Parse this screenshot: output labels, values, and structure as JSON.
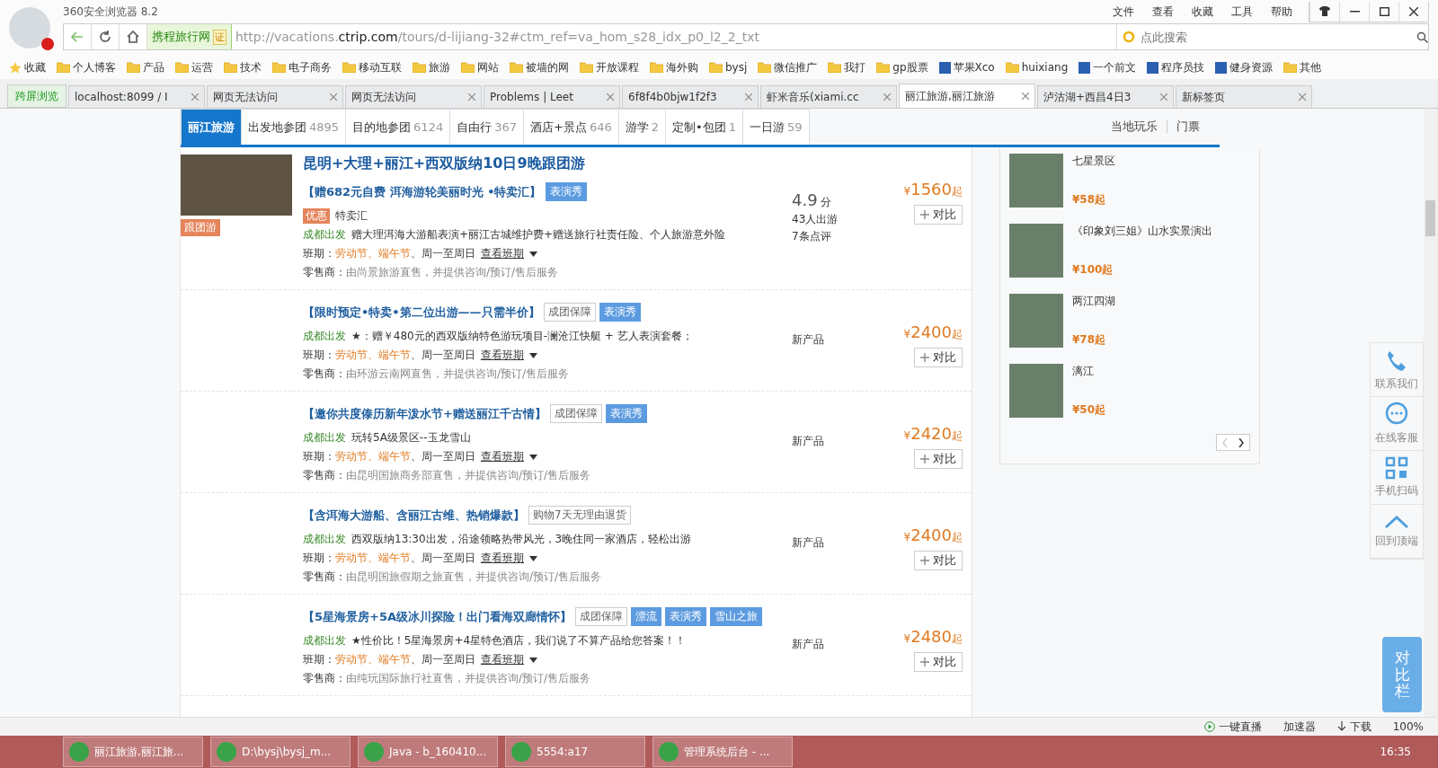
{
  "browser": {
    "title": "360安全浏览器 8.2",
    "menu": [
      "文件",
      "查看",
      "收藏",
      "工具",
      "帮助"
    ],
    "site_label": "携程旅行网",
    "cert": "证",
    "url_host_pre": "http://vacations.",
    "url_host": "ctrip.com",
    "url_path": "/tours/d-lijiang-32#ctm_ref=va_hom_s28_idx_p0_l2_2_txt",
    "search_placeholder": "点此搜索",
    "bookmarks": [
      {
        "label": "收藏",
        "kind": "star"
      },
      {
        "label": "个人博客",
        "kind": "folder"
      },
      {
        "label": "产品",
        "kind": "folder"
      },
      {
        "label": "运营",
        "kind": "folder"
      },
      {
        "label": "技术",
        "kind": "folder"
      },
      {
        "label": "电子商务",
        "kind": "folder"
      },
      {
        "label": "移动互联",
        "kind": "folder"
      },
      {
        "label": "旅游",
        "kind": "folder"
      },
      {
        "label": "网站",
        "kind": "folder"
      },
      {
        "label": "被墙的网",
        "kind": "folder"
      },
      {
        "label": "开放课程",
        "kind": "folder"
      },
      {
        "label": "海外购",
        "kind": "folder"
      },
      {
        "label": "bysj",
        "kind": "folder"
      },
      {
        "label": "微信推广",
        "kind": "folder"
      },
      {
        "label": "我打",
        "kind": "folder"
      },
      {
        "label": "gp股票",
        "kind": "folder"
      },
      {
        "label": "苹果Xco",
        "kind": "site"
      },
      {
        "label": "huixiang",
        "kind": "folder"
      },
      {
        "label": "一个前文",
        "kind": "site"
      },
      {
        "label": "程序员技",
        "kind": "site"
      },
      {
        "label": "健身资源",
        "kind": "site"
      },
      {
        "label": "其他",
        "kind": "folder"
      }
    ],
    "cross_screen": "跨屏浏览",
    "tabs": [
      {
        "label": "localhost:8099 / I",
        "selected": false
      },
      {
        "label": "网页无法访问",
        "selected": false
      },
      {
        "label": "网页无法访问",
        "selected": false
      },
      {
        "label": "Problems | Leet",
        "selected": false
      },
      {
        "label": "6f8f4b0bjw1f2f3",
        "selected": false
      },
      {
        "label": "虾米音乐(xiami.cc",
        "selected": false
      },
      {
        "label": "丽江旅游,丽江旅游",
        "selected": true
      },
      {
        "label": "泸沽湖+西昌4日3",
        "selected": false
      },
      {
        "label": "新标签页",
        "selected": false
      }
    ]
  },
  "nav": {
    "tabs": [
      {
        "label": "丽江旅游",
        "selected": true
      },
      {
        "label": "出发地参团",
        "count": "4895",
        "selected": false
      },
      {
        "label": "目的地参团",
        "count": "6124",
        "selected": false
      },
      {
        "label": "自由行",
        "count": "367",
        "selected": false
      },
      {
        "label": "酒店+景点",
        "count": "646",
        "selected": false
      },
      {
        "label": "游学",
        "count": "2",
        "selected": false
      },
      {
        "label": "定制•包团",
        "count": "1",
        "selected": false
      },
      {
        "label": "一日游",
        "count": "59",
        "selected": false
      }
    ],
    "links": [
      "当地玩乐",
      "门票"
    ]
  },
  "first_product": {
    "title": "昆明+大理+丽江+西双版纳10日9晚跟团游",
    "type_badge": "跟团游",
    "promo_badge": "优惠",
    "promo_text": "特卖汇",
    "score": "4.9",
    "score_unit": "分",
    "travelers": "43人出游",
    "reviews": "7条点评"
  },
  "products": [
    {
      "subtitle": "【赠682元自费 洱海游轮美丽时光 •特卖汇】",
      "tags": [
        {
          "label": "表演秀",
          "kind": "blue"
        }
      ],
      "departure": "成都出发",
      "desc": "赠大理洱海大游船表演+丽江古城维护费+赠送旅行社责任险、个人旅游意外险",
      "schedule_label": "班期：",
      "holidays": "劳动节、端午节",
      "days": "、周一至周日",
      "schedule_link": "查看班期",
      "retailer_label": "零售商：",
      "retailer": "由尚景旅游",
      "retailer_note": "直售，并提供咨询/预订/售后服务",
      "currency": "¥",
      "price": "1560",
      "suffix": "起",
      "compare": "对比"
    },
    {
      "subtitle": "【限时预定•特卖•第二位出游——只需半价】",
      "tags": [
        {
          "label": "成团保障",
          "kind": "plain"
        },
        {
          "label": "表演秀",
          "kind": "blue"
        }
      ],
      "departure": "成都出发",
      "desc": "★：赠￥480元的西双版纳特色游玩项目-澜沧江快艇 + 艺人表演套餐；",
      "schedule_label": "班期：",
      "holidays": "劳动节、端午节",
      "days": "、周一至周日",
      "schedule_link": "查看班期",
      "retailer_label": "零售商：",
      "retailer": "由环游云南网",
      "retailer_note": "直售，并提供咨询/预订/售后服务",
      "note": "新产品",
      "currency": "¥",
      "price": "2400",
      "suffix": "起",
      "compare": "对比"
    },
    {
      "subtitle": "【邀你共度傣历新年泼水节+赠送丽江千古情】",
      "tags": [
        {
          "label": "成团保障",
          "kind": "plain"
        },
        {
          "label": "表演秀",
          "kind": "blue"
        }
      ],
      "departure": "成都出发",
      "desc": "玩转5A级景区--玉龙雪山",
      "schedule_label": "班期：",
      "holidays": "劳动节、端午节",
      "days": "、周一至周日",
      "schedule_link": "查看班期",
      "retailer_label": "零售商：",
      "retailer": "由昆明国旅商务部",
      "retailer_note": "直售，并提供咨询/预订/售后服务",
      "note": "新产品",
      "currency": "¥",
      "price": "2420",
      "suffix": "起",
      "compare": "对比"
    },
    {
      "subtitle": "【含洱海大游船、含丽江古维、热销爆款】",
      "tags": [
        {
          "label": "购物7天无理由退货",
          "kind": "plain"
        }
      ],
      "departure": "成都出发",
      "desc": "西双版纳13:30出发，沿途领略热带风光，3晚住同一家酒店，轻松出游",
      "schedule_label": "班期：",
      "holidays": "劳动节、端午节",
      "days": "、周一至周日",
      "schedule_link": "查看班期",
      "retailer_label": "零售商：",
      "retailer": "由昆明国旅假期之旅",
      "retailer_note": "直售，并提供咨询/预订/售后服务",
      "note": "新产品",
      "currency": "¥",
      "price": "2400",
      "suffix": "起",
      "compare": "对比"
    },
    {
      "subtitle": "【5星海景房+5A级冰川探险！出门看海双廊情怀】",
      "tags": [
        {
          "label": "成团保障",
          "kind": "plain"
        },
        {
          "label": "漂流",
          "kind": "blue"
        },
        {
          "label": "表演秀",
          "kind": "blue"
        },
        {
          "label": "雪山之旅",
          "kind": "blue"
        }
      ],
      "departure": "成都出发",
      "desc": "★性价比！5星海景房+4星特色酒店，我们说了不算产品给您答案！！",
      "schedule_label": "班期：",
      "holidays": "劳动节、端午节",
      "days": "、周一至周日",
      "schedule_link": "查看班期",
      "retailer_label": "零售商：",
      "retailer": "由纯玩国际旅行社",
      "retailer_note": "直售，并提供咨询/预订/售后服务",
      "note": "新产品",
      "currency": "¥",
      "price": "2480",
      "suffix": "起",
      "compare": "对比"
    }
  ],
  "attractions": [
    {
      "name": "七星景区",
      "price": "¥58起"
    },
    {
      "name": "《印象刘三姐》山水实景演出",
      "price": "¥100起"
    },
    {
      "name": "两江四湖",
      "price": "¥78起"
    },
    {
      "name": "漓江",
      "price": "¥50起"
    }
  ],
  "side_tools": [
    {
      "label": "联系我们",
      "kind": "phone"
    },
    {
      "label": "在线客服",
      "kind": "chat"
    },
    {
      "label": "手机扫码",
      "kind": "qr"
    },
    {
      "label": "回到顶端",
      "kind": "top"
    }
  ],
  "compare_bar": "对比栏",
  "status_bar": {
    "live": "一键直播",
    "accelerator": "加速器",
    "download": "下载",
    "zoom": "100%"
  },
  "taskbar": {
    "items": [
      "丽江旅游,丽江旅...",
      "D:\\bysj\\bysj_m...",
      "Java - b_160410...",
      "5554:a17",
      "管理系统后台 - ..."
    ],
    "time": "16:35"
  }
}
